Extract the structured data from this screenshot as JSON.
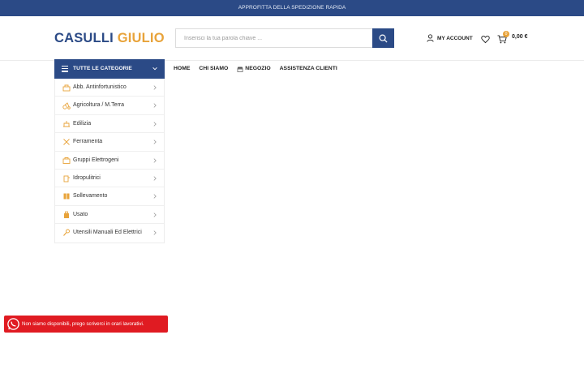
{
  "topbar": {
    "text": "APPROFITTA DELLA SPEDIZIONE RAPIDA"
  },
  "header": {
    "logo_part1": "CASULLI",
    "logo_part2": "GIULIO",
    "search_placeholder": "Inserisci la tua parola chiave ...",
    "account_label": "MY ACCOUNT",
    "cart_count": "0",
    "cart_total": "0,00 €"
  },
  "categories": {
    "button_label": "TUTTE LE CATEGORIE",
    "items": [
      {
        "label": "Abb. Antinfortunistico",
        "icon": "safety-gear-icon"
      },
      {
        "label": "Agricoltura / M.Terra",
        "icon": "agriculture-icon"
      },
      {
        "label": "Edilizia",
        "icon": "construction-icon"
      },
      {
        "label": "Ferramenta",
        "icon": "tools-icon"
      },
      {
        "label": "Gruppi Elettrogeni",
        "icon": "generator-icon"
      },
      {
        "label": "Idropulitrici",
        "icon": "pressure-washer-icon"
      },
      {
        "label": "Sollevamento",
        "icon": "lifting-icon"
      },
      {
        "label": "Usato",
        "icon": "used-goods-icon"
      },
      {
        "label": "Utensili Manuali Ed Elettrici",
        "icon": "power-tools-icon"
      }
    ]
  },
  "nav": {
    "home": "HOME",
    "about": "CHI SIAMO",
    "shop": "NEGOZIO",
    "support": "ASSISTENZA CLIENTI"
  },
  "whatsapp": {
    "text": "Non siamo disponibili, prego scriverci in orari lavorativi."
  },
  "colors": {
    "primary": "#2b4a86",
    "accent": "#e8a33a",
    "whatsapp_banner": "#e01b22"
  }
}
